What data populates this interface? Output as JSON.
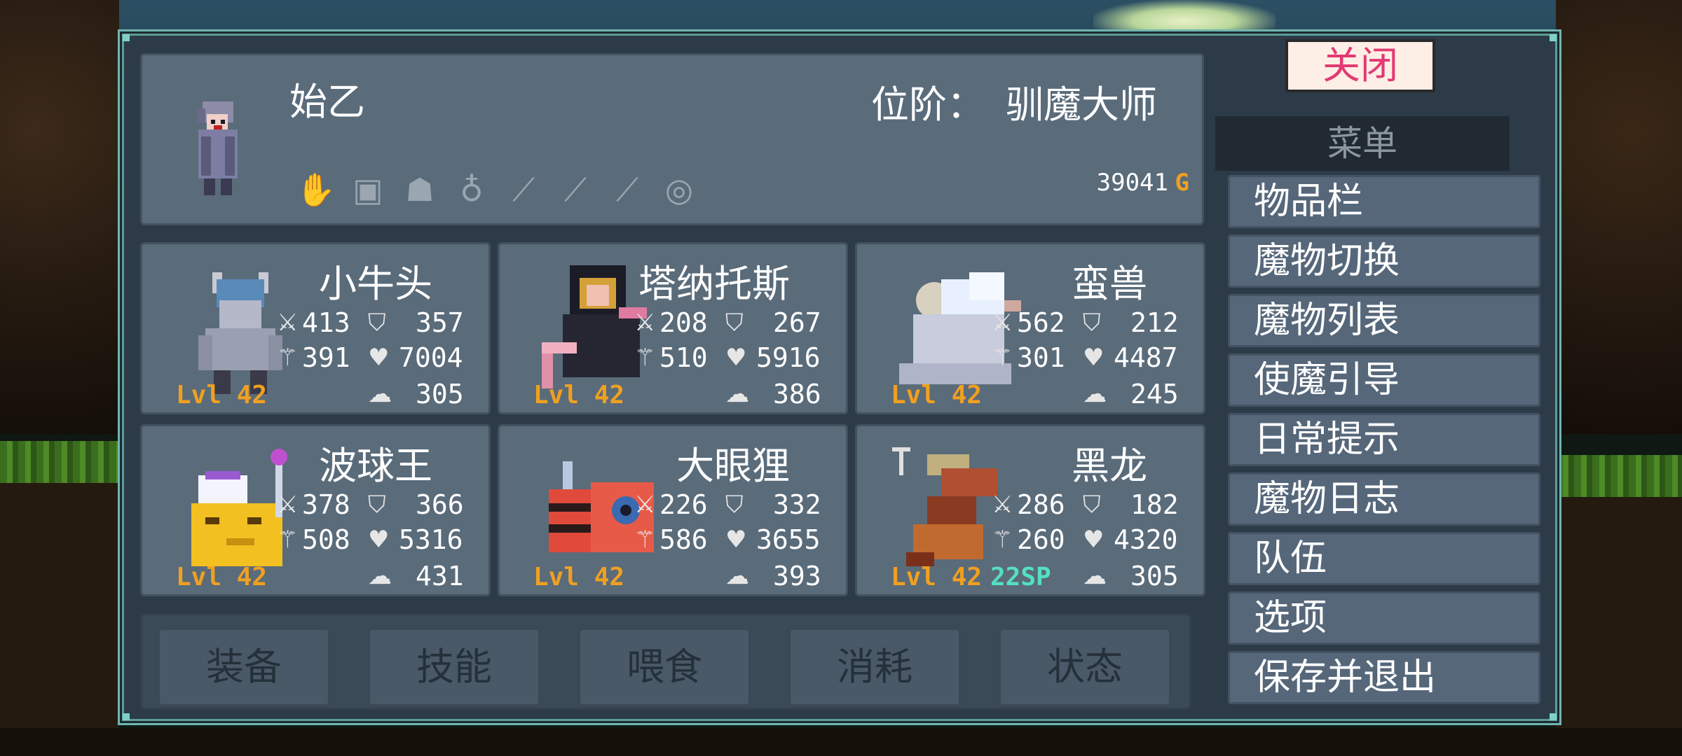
{
  "player": {
    "name": "始乙",
    "rank_label": "位阶：",
    "rank": "驯魔大师",
    "gold": "39041",
    "gold_unit": "G",
    "equipment_icons": [
      "claw-icon",
      "armor-icon",
      "helmet-icon",
      "ring-icon",
      "feather-icon",
      "feather-icon",
      "feather-icon",
      "bracelet-icon"
    ]
  },
  "monsters": [
    {
      "name": "小牛头",
      "atk": "413",
      "def": "357",
      "mag": "391",
      "hp": "7004",
      "mana": "305",
      "level": "Lvl 42",
      "sp": ""
    },
    {
      "name": "塔纳托斯",
      "atk": "208",
      "def": "267",
      "mag": "510",
      "hp": "5916",
      "mana": "386",
      "level": "Lvl 42",
      "sp": ""
    },
    {
      "name": "蛮兽",
      "atk": "562",
      "def": "212",
      "mag": "301",
      "hp": "4487",
      "mana": "245",
      "level": "Lvl 42",
      "sp": ""
    },
    {
      "name": "波球王",
      "atk": "378",
      "def": "366",
      "mag": "508",
      "hp": "5316",
      "mana": "431",
      "level": "Lvl 42",
      "sp": ""
    },
    {
      "name": "大眼狸",
      "atk": "226",
      "def": "332",
      "mag": "586",
      "hp": "3655",
      "mana": "393",
      "level": "Lvl 42",
      "sp": ""
    },
    {
      "name": "黑龙",
      "atk": "286",
      "def": "182",
      "mag": "260",
      "hp": "4320",
      "mana": "305",
      "level": "Lvl 42",
      "sp": "22SP"
    }
  ],
  "actions": [
    "装备",
    "技能",
    "喂食",
    "消耗",
    "状态"
  ],
  "close_label": "关闭",
  "menu": {
    "header": "菜单",
    "items": [
      "物品栏",
      "魔物切换",
      "魔物列表",
      "使魔引导",
      "日常提示",
      "魔物日志",
      "队伍",
      "选项",
      "保存并退出"
    ]
  },
  "colors": {
    "window_bg": "#2d3b48",
    "panel_bg": "#5a6b7a",
    "border_teal": "#6fb6b0",
    "level_orange": "#f0a020",
    "sp_teal": "#55e0c0",
    "close_text": "#e23a73"
  }
}
